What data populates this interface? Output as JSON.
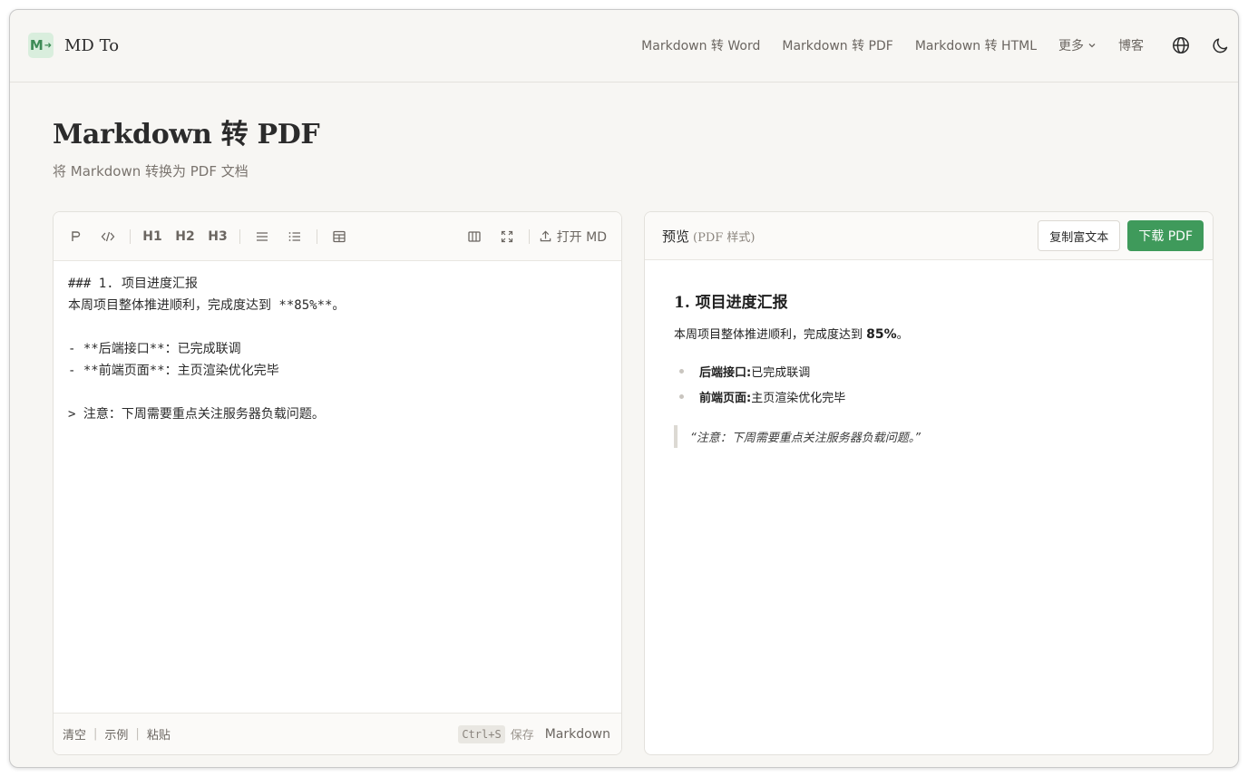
{
  "brand": {
    "logo_glyph": "M",
    "logo_arrow": "➜",
    "name": "MD To"
  },
  "nav": {
    "links": [
      "Markdown 转 Word",
      "Markdown 转 PDF",
      "Markdown 转 HTML"
    ],
    "more": "更多",
    "blog": "博客",
    "icons": [
      "globe-icon",
      "moon-icon"
    ]
  },
  "page": {
    "title": "Markdown 转 PDF",
    "subtitle": "将 Markdown 转换为 PDF 文档"
  },
  "editor": {
    "toolbar": {
      "buttons": [
        "paragraph-icon",
        "code-icon",
        "H1",
        "H2",
        "H3",
        "bullet-list-icon",
        "ordered-list-icon",
        "table-icon",
        "split-view-icon",
        "fullscreen-icon"
      ],
      "h1": "H1",
      "h2": "H2",
      "h3": "H3",
      "open_label": "打开 MD"
    },
    "content": "### 1. 项目进度汇报\n本周项目整体推进顺利，完成度达到 **85%**。\n\n- **后端接口**：已完成联调\n- **前端页面**：主页渲染优化完毕\n\n> 注意：下周需要重点关注服务器负载问题。",
    "footer": {
      "clear": "清空",
      "example": "示例",
      "paste": "粘贴",
      "shortcut": "Ctrl+S",
      "save": "保存",
      "mode": "Markdown"
    }
  },
  "preview": {
    "title": "预览",
    "title_sub": "(PDF 样式)",
    "copy_label": "复制富文本",
    "download_label": "下载 PDF",
    "heading": "1. 项目进度汇报",
    "paragraph_prefix": "本周项目整体推进顺利，完成度达到 ",
    "paragraph_bold": "85%",
    "paragraph_suffix": "。",
    "list": [
      {
        "bold": "后端接口:",
        "text": " 已完成联调"
      },
      {
        "bold": "前端页面:",
        "text": " 主页渲染优化完毕"
      }
    ],
    "quote": "“注意：下周需要重点关注服务器负载问题。”"
  },
  "colors": {
    "accent": "#3f9a5b",
    "background": "#f7f6f3",
    "text": "#2b2b2b",
    "muted": "#6b6661"
  }
}
